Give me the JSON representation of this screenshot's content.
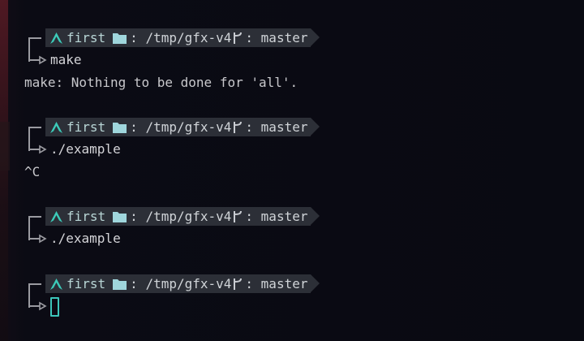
{
  "colors": {
    "background": "#0a0b13",
    "segment_bg": "#2c2f37",
    "host_icon": "#3ccbb9",
    "folder_icon": "#9fd6dc",
    "cursor": "#3cc5ba",
    "text": "#c8c8cc"
  },
  "prompt_common": {
    "host": "first",
    "dir": ": /tmp/gfx-v4",
    "git": ": master"
  },
  "entries": [
    {
      "command": "make",
      "output": "make: Nothing to be done for 'all'."
    },
    {
      "command": "./example",
      "output": "^C"
    },
    {
      "command": "./example",
      "output": ""
    },
    {
      "command": "",
      "output": ""
    }
  ],
  "icons": {
    "host": "arch-linux-icon",
    "dir": "folder-icon",
    "git": "git-branch-icon",
    "corner": "prompt-corner-icon",
    "arrow": "prompt-arrow-icon"
  }
}
